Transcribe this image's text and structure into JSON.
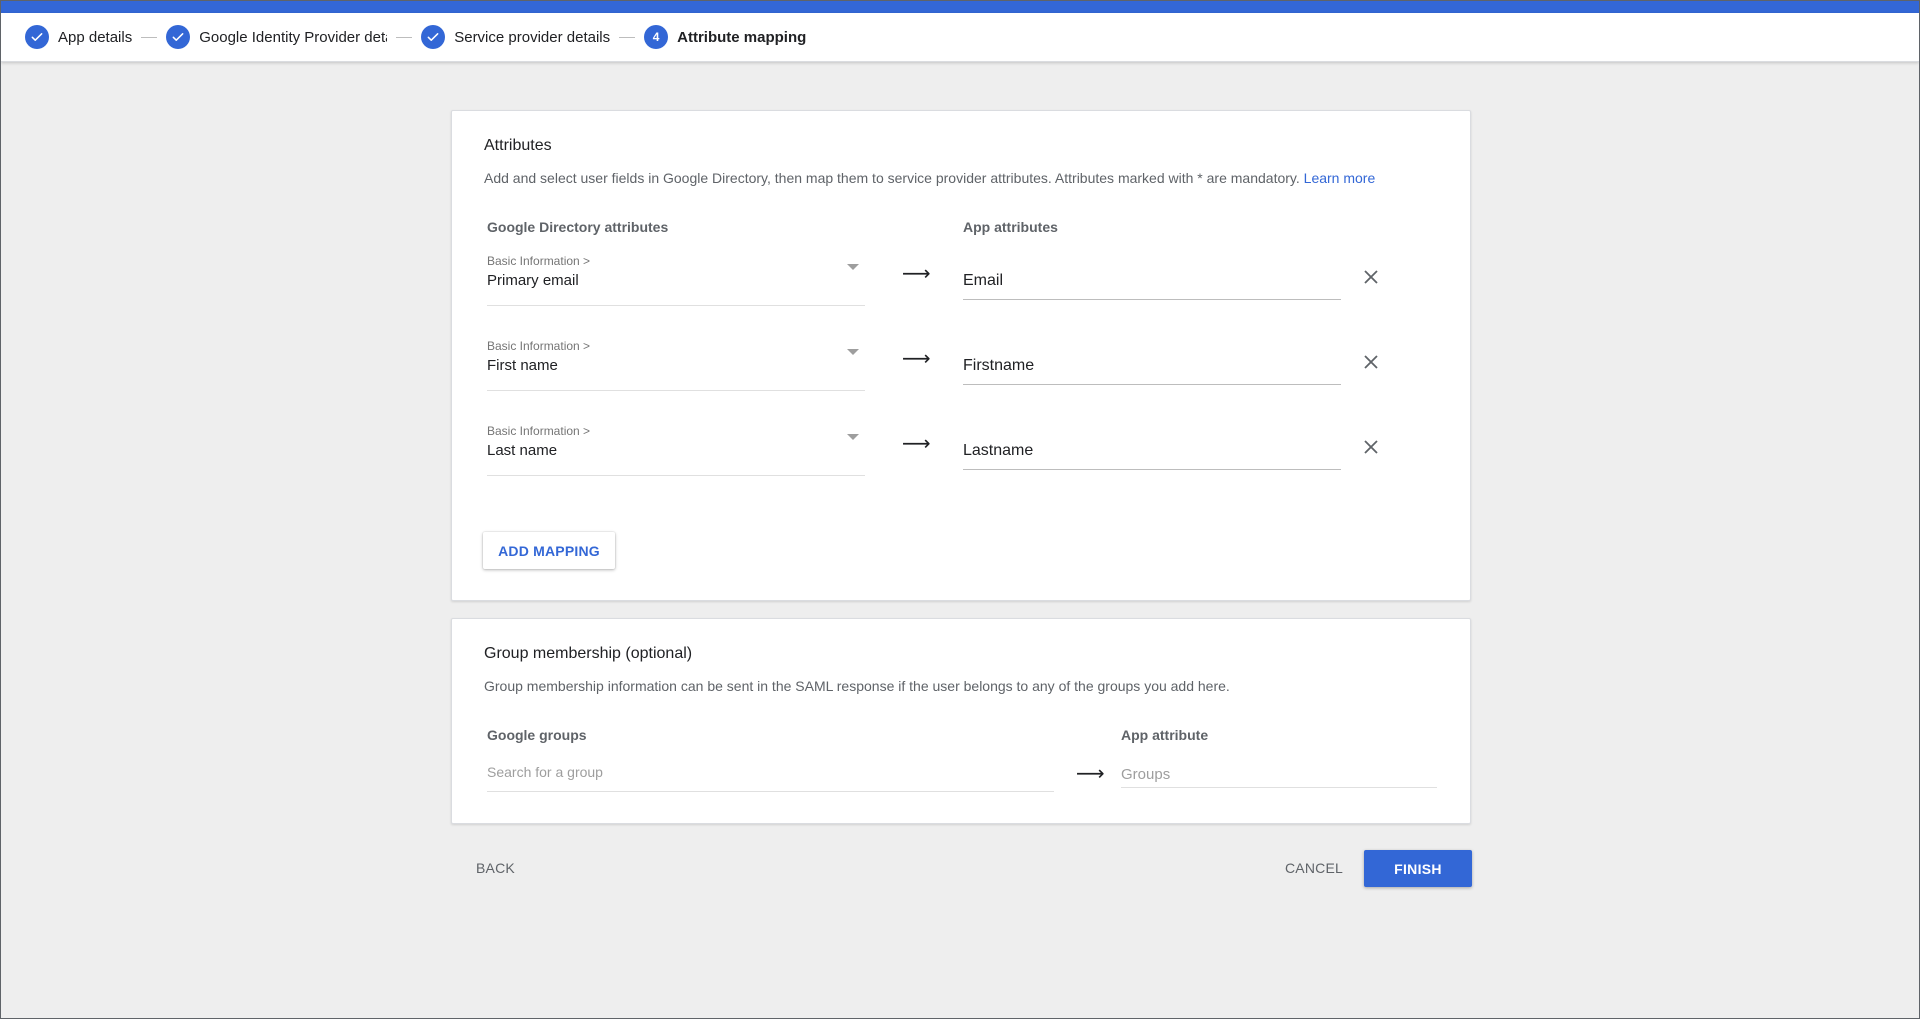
{
  "stepper": {
    "steps": [
      {
        "label": "App details",
        "state": "done",
        "icon": "check-icon"
      },
      {
        "label": "Google Identity Provider details",
        "state": "done",
        "icon": "check-icon"
      },
      {
        "label": "Service provider details",
        "state": "done",
        "icon": "check-icon"
      },
      {
        "label": "Attribute mapping",
        "state": "active",
        "number": "4"
      }
    ]
  },
  "attributes": {
    "title": "Attributes",
    "description": "Add and select user fields in Google Directory, then map them to service provider attributes. Attributes marked with * are mandatory.",
    "learn_more": "Learn more",
    "col_directory": "Google Directory attributes",
    "col_app": "App attributes",
    "mappings": [
      {
        "category": "Basic Information >",
        "field": "Primary email",
        "app_attribute": "Email"
      },
      {
        "category": "Basic Information >",
        "field": "First name",
        "app_attribute": "Firstname"
      },
      {
        "category": "Basic Information >",
        "field": "Last name",
        "app_attribute": "Lastname"
      }
    ],
    "add_mapping_label": "ADD MAPPING"
  },
  "group_membership": {
    "title": "Group membership (optional)",
    "description": "Group membership information can be sent in the SAML response if the user belongs to any of the groups you add here.",
    "col_groups": "Google groups",
    "col_app": "App attribute",
    "search_placeholder": "Search for a group",
    "app_placeholder": "Groups"
  },
  "footer": {
    "back_label": "BACK",
    "cancel_label": "CANCEL",
    "finish_label": "FINISH"
  },
  "colors": {
    "accent": "#3367d6",
    "background": "#eeeeee"
  }
}
